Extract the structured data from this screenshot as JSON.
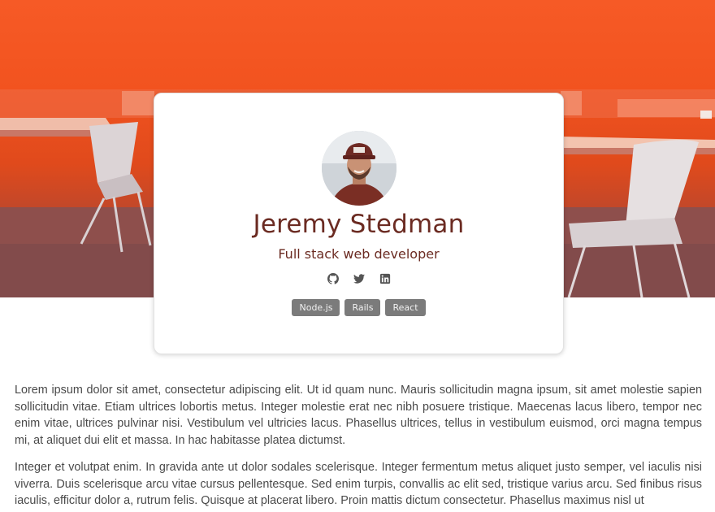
{
  "profile": {
    "name": "Jeremy Stedman",
    "title": "Full stack web developer",
    "socials": [
      {
        "name": "github-icon"
      },
      {
        "name": "twitter-icon"
      },
      {
        "name": "linkedin-icon"
      }
    ],
    "tags": [
      "Node.js",
      "Rails",
      "React"
    ]
  },
  "content": {
    "paragraphs": [
      "Lorem ipsum dolor sit amet, consectetur adipiscing elit. Ut id quam nunc. Mauris sollicitudin magna ipsum, sit amet molestie sapien sollicitudin vitae. Etiam ultrices lobortis metus. Integer molestie erat nec nibh posuere tristique. Maecenas lacus libero, tempor nec enim vitae, ultrices pulvinar nisi. Vestibulum vel ultricies lacus. Phasellus ultrices, tellus in vestibulum euismod, orci magna tempus mi, at aliquet dui elit et massa. In hac habitasse platea dictumst.",
      "Integer et volutpat enim. In gravida ante ut dolor sodales scelerisque. Integer fermentum metus aliquet justo semper, vel iaculis nisi viverra. Duis scelerisque arcu vitae cursus pellentesque. Sed enim turpis, convallis ac elit sed, tristique varius arcu. Sed finibus risus iaculis, efficitur dolor a, rutrum felis. Quisque at placerat libero. Proin mattis dictum consectetur. Phasellus maximus nisl ut"
    ]
  },
  "colors": {
    "hero_orange": "#f2531f",
    "name_color": "#6b2b22",
    "tag_bg": "#7b7b7b",
    "body_text": "#4a4a4a"
  }
}
